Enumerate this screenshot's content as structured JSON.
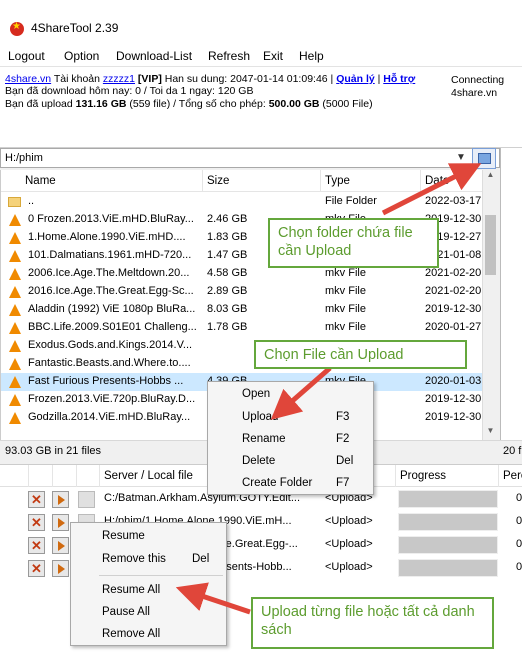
{
  "app": {
    "title": "4ShareTool 2.39"
  },
  "menu": [
    "Logout",
    "Option",
    "Download-List",
    "Refresh",
    "Exit",
    "Help"
  ],
  "info": {
    "site": "4share.vn",
    "account_label": " Tài khoản ",
    "user": "zzzzz1",
    "vip": " [VIP]",
    "expire": " Han su dung: 2047-01-14 01:09:46 | ",
    "manage": "Quản lý",
    "sep": " | ",
    "support": "Hỗ trợ",
    "connecting": "Connecting",
    "host": "4share.vn",
    "line2": "Bạn đã download hôm nay: 0 / Toi da 1 ngay: 120 GB",
    "line3_prefix": "Bạn đã upload ",
    "line3_upload": "131.16 GB",
    "line3_mid": " (559 file) / Tổng số cho phép: ",
    "line3_total": "500.00 GB",
    "line3_suffix": " (5000 File)"
  },
  "path": {
    "value": "H:/phim"
  },
  "filelist": {
    "columns": {
      "name": "Name",
      "size": "Size",
      "type": "Type",
      "date": "Date"
    },
    "rows": [
      {
        "icon": "folder-icon",
        "name": "..",
        "size": "",
        "type": "File Folder",
        "date": "2022-03-17"
      },
      {
        "icon": "vlc-icon",
        "name": "0 Frozen.2013.ViE.mHD.BluRay...",
        "size": "2.46 GB",
        "type": "mkv File",
        "date": "2019-12-30"
      },
      {
        "icon": "vlc-icon",
        "name": "1.Home.Alone.1990.ViE.mHD....",
        "size": "1.83 GB",
        "type": "mkv File",
        "date": "2019-12-27"
      },
      {
        "icon": "vlc-icon",
        "name": "101.Dalmatians.1961.mHD-720...",
        "size": "1.47 GB",
        "type": "mkv File",
        "date": "2021-01-08"
      },
      {
        "icon": "vlc-icon",
        "name": "2006.Ice.Age.The.Meltdown.20...",
        "size": "4.58 GB",
        "type": "mkv File",
        "date": "2021-02-20"
      },
      {
        "icon": "vlc-icon",
        "name": "2016.Ice.Age.The.Great.Egg-Sc...",
        "size": "2.89 GB",
        "type": "mkv File",
        "date": "2021-02-20"
      },
      {
        "icon": "vlc-icon",
        "name": "Aladdin (1992) ViE 1080p BluRa...",
        "size": "8.03 GB",
        "type": "mkv File",
        "date": "2019-12-30"
      },
      {
        "icon": "vlc-icon",
        "name": "BBC.Life.2009.S01E01 Challeng...",
        "size": "1.78 GB",
        "type": "mkv File",
        "date": "2020-01-27"
      },
      {
        "icon": "vlc-icon",
        "name": "Exodus.Gods.and.Kings.2014.V...",
        "size": "",
        "type": "",
        "date": ""
      },
      {
        "icon": "vlc-icon",
        "name": "Fantastic.Beasts.and.Where.to....",
        "size": "",
        "type": "",
        "date": ""
      },
      {
        "icon": "vlc-icon",
        "name": "Fast  Furious Presents-Hobbs ...",
        "size": "4.39 GB",
        "type": "mkv File",
        "date": "2020-01-03"
      },
      {
        "icon": "vlc-icon",
        "name": "Frozen.2013.ViE.720p.BluRay.D...",
        "size": "",
        "type": "",
        "date": "2019-12-30"
      },
      {
        "icon": "vlc-icon",
        "name": "Godzilla.2014.ViE.mHD.BluRay...",
        "size": "",
        "type": "",
        "date": "2019-12-30"
      }
    ],
    "selected_index": 10
  },
  "status": {
    "left": "93.03 GB in 21 files",
    "right": "20 f"
  },
  "queue": {
    "columns": {
      "server": "Server / Local file",
      "progress": "Progress",
      "percent": "Perc"
    },
    "rows": [
      {
        "file": "C:/Batman.Arkham.Asylum.GOTY.Edit...",
        "action": "<Upload>",
        "percent": "0"
      },
      {
        "file": "H:/phim/1.Home.Alone.1990.ViE.mH...",
        "action": "<Upload>",
        "percent": "0"
      },
      {
        "file": "H:/phim/2016.Ice.Age.The.Great.Egg-...",
        "action": "<Upload>",
        "percent": "0"
      },
      {
        "file": "H:/phim/Fast  Furious Presents-Hobb...",
        "action": "<Upload>",
        "percent": "0"
      }
    ]
  },
  "context_file": [
    {
      "label": "Open",
      "key": ""
    },
    {
      "label": "Upload",
      "key": "F3"
    },
    {
      "label": "Rename",
      "key": "F2"
    },
    {
      "label": "Delete",
      "key": "Del"
    },
    {
      "label": "Create Folder",
      "key": "F7"
    }
  ],
  "context_queue": [
    {
      "label": "Resume",
      "key": ""
    },
    {
      "label": "Remove this",
      "key": "Del"
    },
    {
      "label": "Resume All",
      "key": ""
    },
    {
      "label": "Pause All",
      "key": ""
    },
    {
      "label": "Remove All",
      "key": ""
    }
  ],
  "callouts": {
    "folder": "Chọn folder chứa file cần Upload",
    "file": "Chọn File cần Upload",
    "all": "Upload từng file hoặc tất cả danh sách"
  },
  "colors": {
    "arrow": "#e0463a",
    "callout_border": "#64a73c",
    "callout_text": "#5c9c2e",
    "selected_row": "#cce8ff"
  }
}
